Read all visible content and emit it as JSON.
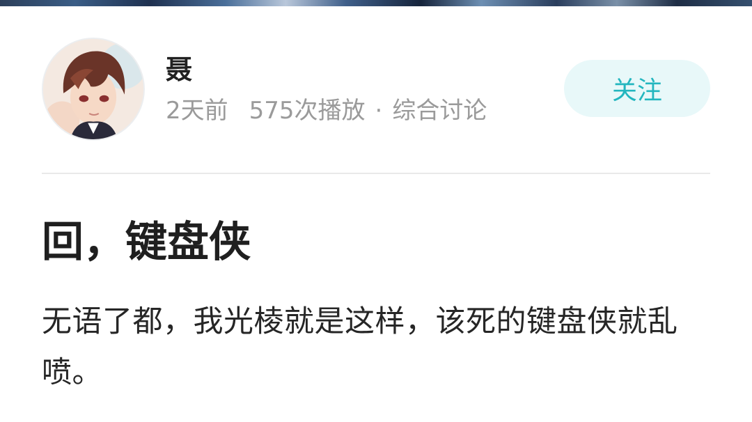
{
  "author": {
    "name": "聂",
    "follow_label": "关注"
  },
  "post": {
    "time": "2天前",
    "plays": "575次播放",
    "separator": "·",
    "category": "综合讨论",
    "title": "回，键盘侠",
    "body": "无语了都，我光棱就是这样，该死的键盘侠就乱喷。"
  },
  "colors": {
    "accent": "#23b6bf",
    "follow_bg": "#e8f8f9",
    "meta_text": "#9a9a9a"
  }
}
